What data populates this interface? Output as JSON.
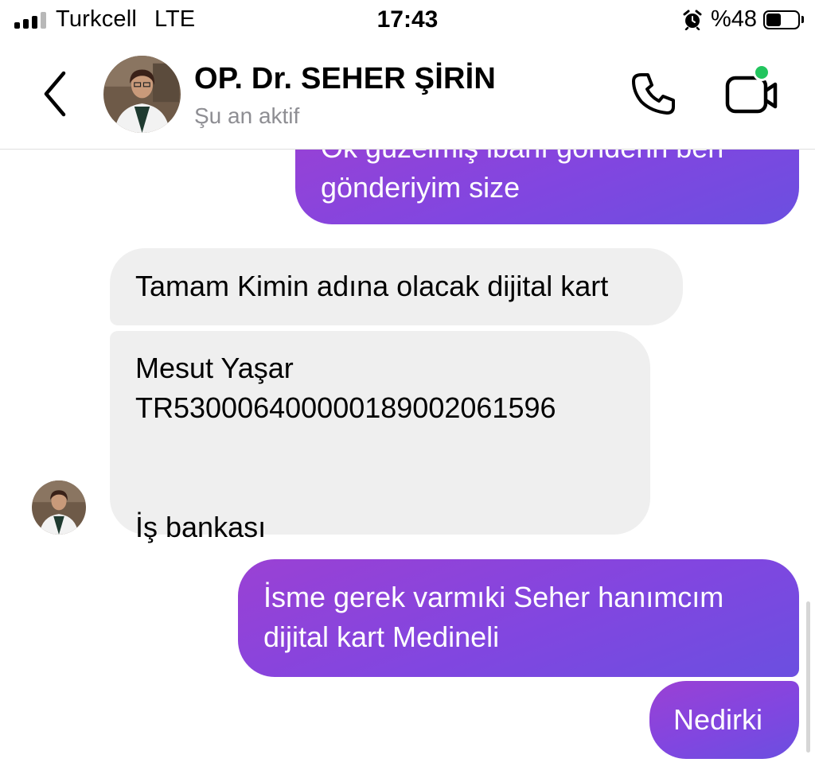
{
  "status_bar": {
    "carrier": "Turkcell",
    "network": "LTE",
    "time": "17:43",
    "alarm_icon": "alarm-clock-icon",
    "battery_label": "%48",
    "battery_level": 0.48
  },
  "header": {
    "contact_name": "OP. Dr. SEHER ŞİRİN",
    "status": "Şu an aktif",
    "online_color": "#22c55e"
  },
  "colors": {
    "outgoing_gradient": [
      "#9a41d4",
      "#8146e0",
      "#6b4fe0"
    ],
    "incoming_bg": "#efefef"
  },
  "messages": [
    {
      "direction": "out",
      "text": "Ok güzelmiş ibanı gönderin ben\ngönderiyim size"
    },
    {
      "direction": "in",
      "text": "Tamam Kimin adına olacak dijital kart"
    },
    {
      "direction": "in",
      "text": "Mesut Yaşar\nTR530006400000189002061596\n\n\nİş bankası"
    },
    {
      "direction": "out",
      "text": "İsme gerek varmıki Seher hanımcım\ndijital kart Medineli"
    },
    {
      "direction": "out",
      "text": "Nedirki"
    }
  ]
}
